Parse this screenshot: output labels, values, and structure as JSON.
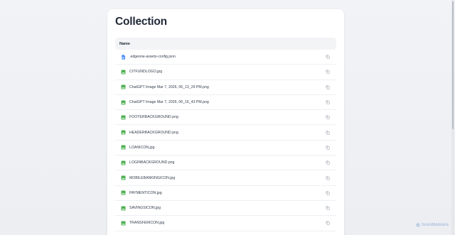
{
  "collection": {
    "title": "Collection",
    "column_header": "Name",
    "files": [
      {
        "name": ".edgeone-assets-config.json",
        "type": "json"
      },
      {
        "name": "CITFUNDLOGO.jpg",
        "type": "image"
      },
      {
        "name": "ChatGPT Image Mar 7, 2026, 06_13_29 PM.png",
        "type": "image"
      },
      {
        "name": "ChatGPT Image Mar 7, 2026, 06_16_43 PM.png",
        "type": "image"
      },
      {
        "name": "FOOTERBACKGROUND.png",
        "type": "image"
      },
      {
        "name": "HEADERBACKGROUND.png",
        "type": "image"
      },
      {
        "name": "LOANICON.jpg",
        "type": "image"
      },
      {
        "name": "LOGINBACKGROUND.png",
        "type": "image"
      },
      {
        "name": "MOBILEBANKINGICON.jpg",
        "type": "image"
      },
      {
        "name": "PAYMENTICON.jpg",
        "type": "image"
      },
      {
        "name": "SAVINGSICON.jpg",
        "type": "image"
      },
      {
        "name": "TRANSFERICON.jpg",
        "type": "image"
      }
    ]
  },
  "watermark": {
    "text": "ScanMalware"
  },
  "colors": {
    "json_icon": "#3b82f6",
    "image_icon": "#4caf50",
    "copy_icon": "#9ca3af"
  }
}
